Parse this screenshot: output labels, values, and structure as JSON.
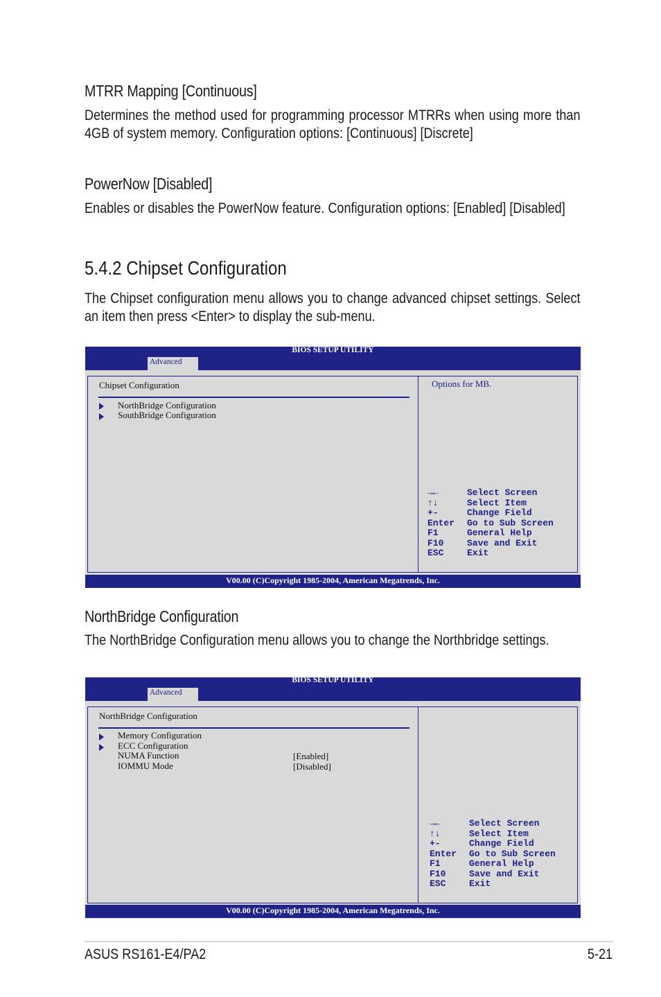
{
  "sections": {
    "mtrr": {
      "heading": "MTRR Mapping [Continuous]",
      "body": "Determines the method used for programming processor MTRRs when using more than 4GB of system memory. Configuration options: [Continuous] [Discrete]"
    },
    "powernow": {
      "heading": "PowerNow [Disabled]",
      "body": "Enables or disables the PowerNow feature. Configuration options: [Enabled] [Disabled]"
    },
    "chipset": {
      "heading": "5.4.2 Chipset Configuration",
      "body": "The Chipset configuration menu allows you to change advanced chipset settings. Select an item then press <Enter> to display the sub-menu."
    },
    "northbridge": {
      "heading": "NorthBridge Configuration",
      "body": "The NorthBridge Configuration menu allows you to change the Northbridge settings."
    }
  },
  "bios1": {
    "title": "BIOS SETUP UTILITY",
    "tab": "Advanced",
    "panel_title": "Chipset Configuration",
    "items": [
      {
        "label": "NorthBridge Configuration",
        "submenu": true
      },
      {
        "label": "SouthBridge Configuration",
        "submenu": true
      }
    ],
    "help": "Options for MB.",
    "keys": [
      {
        "key": "→←",
        "action": "Select Screen"
      },
      {
        "key": "↑↓",
        "action": "Select Item"
      },
      {
        "key": "+-",
        "action": "Change Field"
      },
      {
        "key": "Enter",
        "action": "Go to Sub Screen"
      },
      {
        "key": "F1",
        "action": "General Help"
      },
      {
        "key": "F10",
        "action": "Save and Exit"
      },
      {
        "key": "ESC",
        "action": "Exit"
      }
    ],
    "footer": "V00.00 (C)Copyright 1985-2004, American Megatrends, Inc."
  },
  "bios2": {
    "title": "BIOS SETUP UTILITY",
    "tab": "Advanced",
    "panel_title": "NorthBridge Configuration",
    "items": [
      {
        "label": "Memory Configuration",
        "submenu": true,
        "value": ""
      },
      {
        "label": "ECC Configuration",
        "submenu": true,
        "value": ""
      },
      {
        "label": "NUMA Function",
        "submenu": false,
        "value": "[Enabled]"
      },
      {
        "label": "IOMMU Mode",
        "submenu": false,
        "value": "[Disabled]"
      }
    ],
    "keys": [
      {
        "key": "→←",
        "action": "Select Screen"
      },
      {
        "key": "↑↓",
        "action": "Select Item"
      },
      {
        "key": "+-",
        "action": "Change Field"
      },
      {
        "key": "Enter",
        "action": "Go to Sub Screen"
      },
      {
        "key": "F1",
        "action": "General Help"
      },
      {
        "key": "F10",
        "action": "Save and Exit"
      },
      {
        "key": "ESC",
        "action": "Exit"
      }
    ],
    "footer": "V00.00 (C)Copyright 1985-2004, American Megatrends, Inc."
  },
  "page_footer": {
    "model": "ASUS RS161-E4/PA2",
    "page_number": "5-21"
  }
}
